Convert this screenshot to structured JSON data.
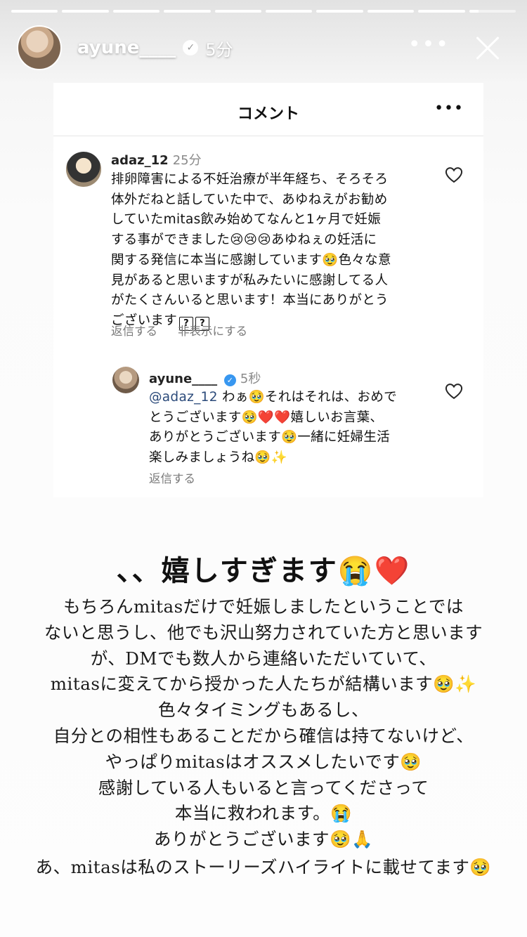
{
  "story": {
    "username": "ayune____",
    "time": "5分",
    "more_label": "•••"
  },
  "sheet": {
    "title": "コメント",
    "more_label": "•••"
  },
  "comment": {
    "username": "adaz_12",
    "time": "25分",
    "lines": [
      "排卵障害による不妊治療が半年経ち、そろそろ",
      "体外だねと話していた中で、あゆねえがお勧め",
      "していたmitas飲み始めてなんと1ヶ月で妊娠",
      "する事ができました😢😢😢あゆねぇの妊活に",
      "関する発信に本当に感謝しています🥹色々な意",
      "見があると思いますが私みたいに感謝してる人",
      "がたくさんいると思います！本当にありがとう",
      "ございます"
    ],
    "unknown_glyph": "?",
    "reply_label": "返信する",
    "hide_label": "非表示にする"
  },
  "reply": {
    "username": "ayune____",
    "time": "5秒",
    "mention": "@adaz_12",
    "line1_rest": " わぁ🥹それはそれは、おめで",
    "lines": [
      "とうございます🥹❤️❤️嬉しいお言葉、",
      "ありがとうございます🥹一緒に妊婦生活",
      "楽しみましょうね🥹✨"
    ],
    "reply_label": "返信する"
  },
  "headline": "、、嬉しすぎます😭❤️",
  "body_lines": [
    "もちろんmitasだけで妊娠しましたということでは",
    "ないと思うし、他でも沢山努力されていた方と思います",
    "が、DMでも数人から連絡いただいていて、",
    "mitasに変えてから授かった人たちが結構います🥹✨",
    "色々タイミングもあるし、",
    "自分との相性もあることだから確信は持てないけど、",
    "やっぱりmitasはオススメしたいです🥹",
    "感謝している人もいると言ってくださって",
    "本当に救われます。😭",
    "ありがとうございます🥹🙏"
  ],
  "final_line": "あ、mitasは私のストーリーズハイライトに載せてます🥹"
}
